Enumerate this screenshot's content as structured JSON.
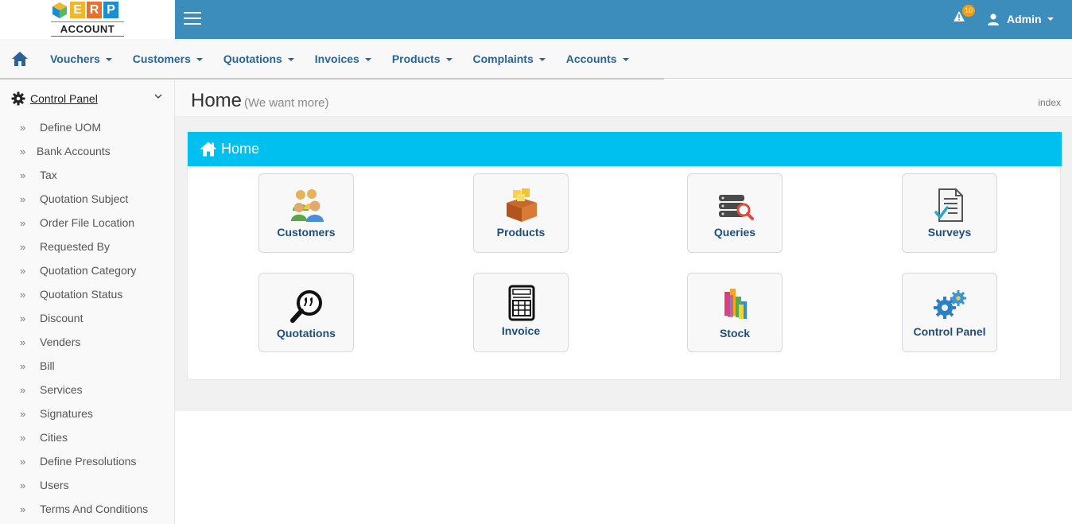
{
  "logo": {
    "letters": [
      "E",
      "R",
      "P"
    ],
    "text": "ACCOUNT"
  },
  "topbar": {
    "notification_count": "10",
    "user_name": "Admin"
  },
  "nav": {
    "items": [
      {
        "label": "Vouchers"
      },
      {
        "label": "Customers"
      },
      {
        "label": "Quotations"
      },
      {
        "label": "Invoices"
      },
      {
        "label": "Products"
      },
      {
        "label": "Complaints"
      },
      {
        "label": "Accounts"
      }
    ]
  },
  "sidebar": {
    "header": "Control Panel",
    "items": [
      {
        "label": "Define UOM"
      },
      {
        "label": "Bank Accounts"
      },
      {
        "label": "Tax"
      },
      {
        "label": "Quotation Subject"
      },
      {
        "label": "Order File Location"
      },
      {
        "label": "Requested By"
      },
      {
        "label": "Quotation Category"
      },
      {
        "label": "Quotation Status"
      },
      {
        "label": "Discount"
      },
      {
        "label": "Venders"
      },
      {
        "label": "Bill"
      },
      {
        "label": "Services"
      },
      {
        "label": "Signatures"
      },
      {
        "label": "Cities"
      },
      {
        "label": "Define Presolutions"
      },
      {
        "label": "Users"
      },
      {
        "label": "Terms And Conditions"
      }
    ]
  },
  "page": {
    "title": "Home",
    "subtitle": "(We want more)",
    "breadcrumb": "index"
  },
  "box": {
    "title": "Home"
  },
  "tiles": [
    {
      "label": "Customers",
      "icon": "customers-icon"
    },
    {
      "label": "Products",
      "icon": "products-icon"
    },
    {
      "label": "Queries",
      "icon": "queries-icon"
    },
    {
      "label": "Surveys",
      "icon": "surveys-icon"
    },
    {
      "label": "Quotations",
      "icon": "quotations-icon"
    },
    {
      "label": "Invoice",
      "icon": "invoice-icon"
    },
    {
      "label": "Stock",
      "icon": "stock-icon"
    },
    {
      "label": "Control Panel",
      "icon": "control-panel-icon"
    }
  ],
  "colors": {
    "topbar": "#3c8dbc",
    "box_header": "#00c0ef",
    "nav_text": "#2a6496",
    "badge": "#f39c12"
  }
}
